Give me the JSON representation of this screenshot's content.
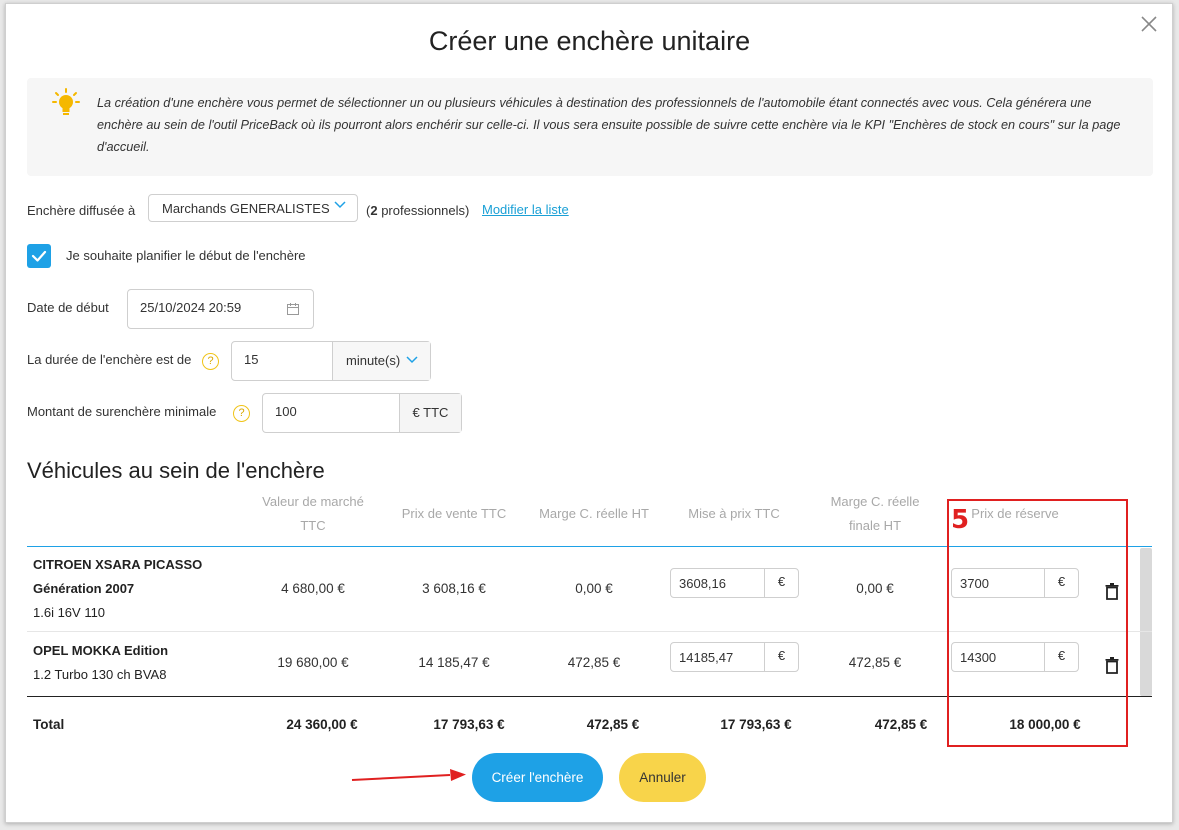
{
  "dialog": {
    "title": "Créer une enchère unitaire"
  },
  "info": {
    "text": "La création d'une enchère vous permet de sélectionner un ou plusieurs véhicules à destination des professionnels de l'automobile étant connectés avec vous. Cela générera une enchère au sein de l'outil PriceBack où ils pourront alors enchérir sur celle-ci. Il vous sera ensuite possible de suivre cette enchère via le KPI \"Enchères de stock en cours\" sur la page d'accueil."
  },
  "form": {
    "broadcast_label": "Enchère diffusée à",
    "broadcast_value": "Marchands GENERALISTES",
    "pros_count": "2",
    "pros_suffix": "professionnels)",
    "pros_prefix": "(",
    "modify_link": "Modifier la liste",
    "schedule_checked": true,
    "schedule_label": "Je souhaite planifier le début de l'enchère",
    "start_label": "Date de début",
    "start_value": "25/10/2024 20:59",
    "duration_label": "La durée de l'enchère est de",
    "duration_value": "15",
    "duration_unit": "minute(s)",
    "overbid_label": "Montant de surenchère minimale",
    "overbid_value": "100",
    "overbid_unit": "€ TTC"
  },
  "vehicles": {
    "section_title": "Véhicules au sein de l'enchère",
    "headers": {
      "market": [
        "Valeur de marché",
        "TTC"
      ],
      "sale": "Prix de vente TTC",
      "margin": "Marge C. réelle HT",
      "listing": "Mise à prix TTC",
      "final_margin": [
        "Marge C. réelle",
        "finale HT"
      ],
      "reserve": "Prix de réserve"
    },
    "rows": [
      {
        "name_l1": "CITROEN XSARA PICASSO",
        "name_l2": "Génération 2007",
        "name_l3": "1.6i 16V 110",
        "market": "4 680,00 €",
        "sale": "3 608,16 €",
        "margin": "0,00 €",
        "listing": "3608,16",
        "final_margin": "0,00 €",
        "reserve": "3700"
      },
      {
        "name_l1": "OPEL MOKKA Edition",
        "name_l2": "1.2 Turbo 130 ch BVA8",
        "market": "19 680,00 €",
        "sale": "14 185,47 €",
        "margin": "472,85 €",
        "listing": "14185,47",
        "final_margin": "472,85 €",
        "reserve": "14300"
      }
    ],
    "currency": "€",
    "totals": {
      "label": "Total",
      "market": "24 360,00 €",
      "sale": "17 793,63 €",
      "margin": "472,85 €",
      "listing": "17 793,63 €",
      "final_margin": "472,85 €",
      "reserve": "18 000,00 €"
    }
  },
  "buttons": {
    "create": "Créer l'enchère",
    "cancel": "Annuler"
  },
  "annotation": {
    "step": "5"
  },
  "colors": {
    "accent": "#1ea1e6",
    "cancel": "#f8d44a",
    "annotation": "#e02020"
  }
}
